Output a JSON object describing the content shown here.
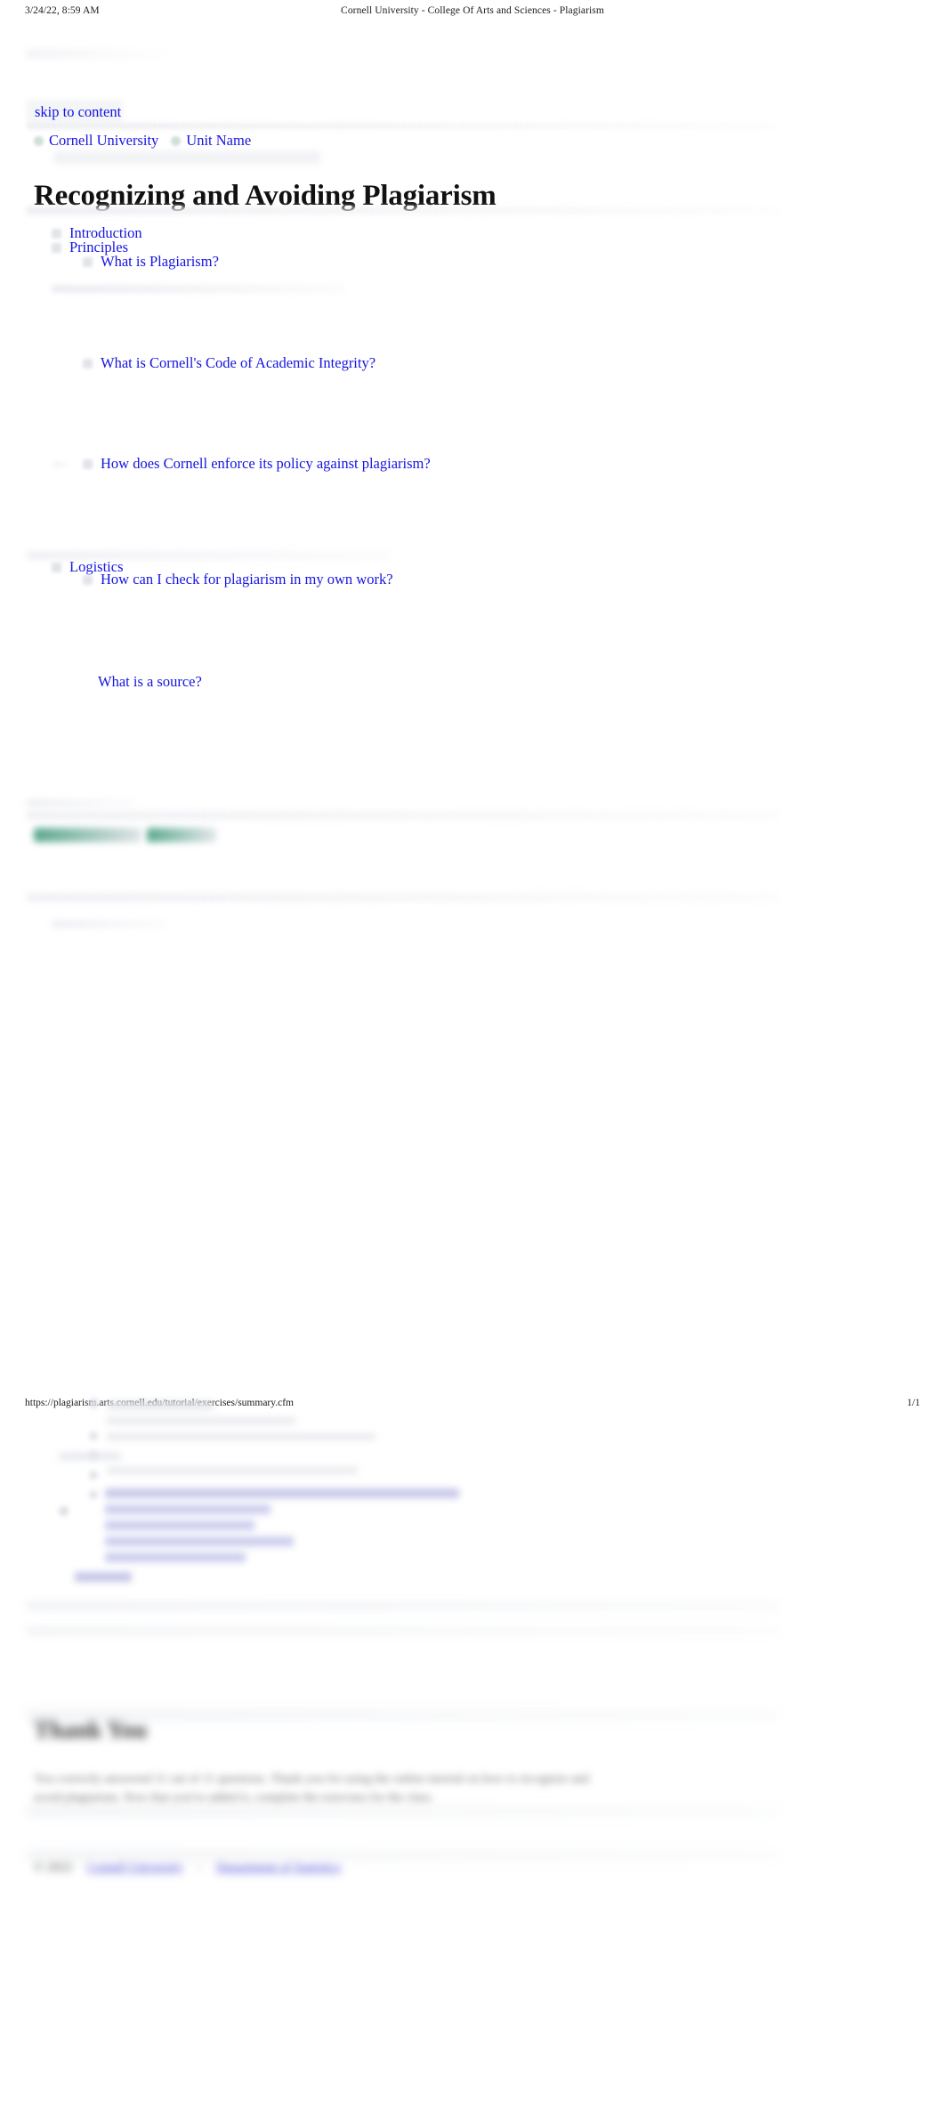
{
  "print_header": {
    "date": "3/24/22, 8:59 AM",
    "title": "Cornell University - College Of Arts and Sciences - Plagiarism"
  },
  "accessibility": {
    "skip_link": "skip to content"
  },
  "breadcrumb": {
    "items": [
      {
        "label": "Cornell University",
        "icon": "bullet-icon"
      },
      {
        "label": "Unit Name",
        "icon": "bullet-icon"
      }
    ]
  },
  "page": {
    "title": "Recognizing and Avoiding Plagiarism"
  },
  "toc": {
    "items": [
      {
        "label": "Introduction",
        "level": 1,
        "bullet": true
      },
      {
        "label": "Principles",
        "level": 1,
        "bullet": true
      },
      {
        "label": "What is Plagiarism?",
        "level": 2,
        "bullet": true
      },
      {
        "label": "What is Cornell's Code of Academic Integrity?",
        "level": 2,
        "bullet": true
      },
      {
        "label": "How does Cornell enforce its policy against plagiarism?",
        "level": 2,
        "bullet": true
      },
      {
        "label": "Logistics",
        "level": 1,
        "bullet": true
      },
      {
        "label": "How can I check for plagiarism in my own work?",
        "level": 2,
        "bullet": true
      },
      {
        "label": "What is a source?",
        "level": 2,
        "bullet": false
      }
    ]
  },
  "print_footer": {
    "url": "https://plagiarism.arts.cornell.edu/tutorial/exercises/summary.cfm",
    "page": "1/1"
  },
  "second_page": {
    "thanks_title": "Thank You",
    "thanks_body": "You correctly answered 11 out of 11 questions. Thank you for using the online tutorial on how to recognize and avoid plagiarism. Now that you've added it, complete the exercises for the class.",
    "bottom": {
      "copyright": "© 2022",
      "links": [
        {
          "label": "Cornell University"
        },
        {
          "label": "Department of Statistics"
        }
      ],
      "separator": "-"
    },
    "blurred_links": [
      {
        "label": "What is the difference between documentation, citation, and reference?"
      },
      {
        "label": "What should I be careful to quote?"
      },
      {
        "label": "How do I document a source?"
      },
      {
        "label": "How do I know how this works anymore?"
      },
      {
        "label": "How can I avoid plagiarism?"
      },
      {
        "label": "Summary"
      }
    ]
  }
}
